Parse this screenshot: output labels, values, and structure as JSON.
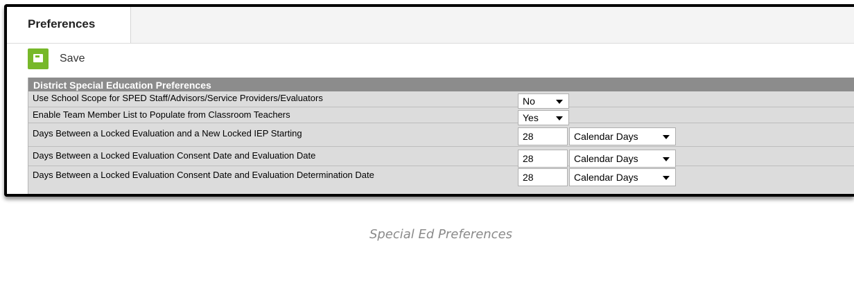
{
  "tabs": [
    {
      "label": "Preferences",
      "active": true
    }
  ],
  "toolbar": {
    "save_label": "Save",
    "save_icon": "save-icon",
    "save_color": "#77b82a"
  },
  "panel": {
    "title": "District Special Education Preferences",
    "rows": [
      {
        "label": "Use School Scope for SPED Staff/Advisors/Service Providers/Evaluators",
        "select_value": "No"
      },
      {
        "label": "Enable Team Member List to Populate from Classroom Teachers",
        "select_value": "Yes"
      },
      {
        "label": "Days Between a Locked Evaluation and a New Locked IEP Starting",
        "input_value": "28",
        "unit_value": "Calendar Days"
      },
      {
        "label": "Days Between a Locked Evaluation Consent Date and Evaluation Date",
        "input_value": "28",
        "unit_value": "Calendar Days"
      },
      {
        "label": "Days Between a Locked Evaluation Consent Date and Evaluation Determination Date",
        "input_value": "28",
        "unit_value": "Calendar Days"
      }
    ]
  },
  "caption": "Special Ed Preferences"
}
